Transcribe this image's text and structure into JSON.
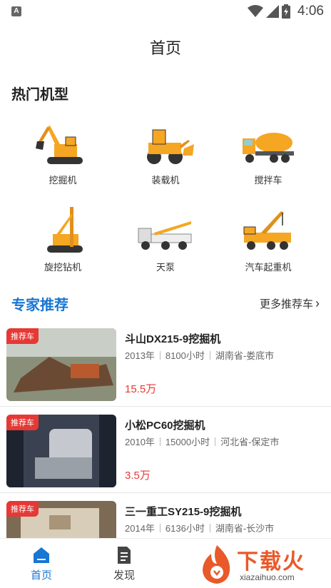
{
  "status": {
    "time": "4:06",
    "app_icon_letter": "A"
  },
  "header": {
    "title": "首页"
  },
  "hot_models": {
    "title": "热门机型",
    "items": [
      {
        "label": "挖掘机",
        "icon": "excavator-icon"
      },
      {
        "label": "装载机",
        "icon": "loader-icon"
      },
      {
        "label": "搅拌车",
        "icon": "mixer-truck-icon"
      },
      {
        "label": "旋挖钻机",
        "icon": "rotary-drill-icon"
      },
      {
        "label": "天泵",
        "icon": "pump-truck-icon"
      },
      {
        "label": "汽车起重机",
        "icon": "truck-crane-icon"
      }
    ]
  },
  "recommend": {
    "title": "专家推荐",
    "more_label": "更多推荐车",
    "badge": "推荐车",
    "items": [
      {
        "title": "斗山DX215-9挖掘机",
        "year": "2013年",
        "hours": "8100小时",
        "location": "湖南省-娄底市",
        "price": "15.5万"
      },
      {
        "title": "小松PC60挖掘机",
        "year": "2010年",
        "hours": "15000小时",
        "location": "河北省-保定市",
        "price": "3.5万"
      },
      {
        "title": "三一重工SY215-9挖掘机",
        "year": "2014年",
        "hours": "6136小时",
        "location": "湖南省-长沙市",
        "price": ""
      }
    ]
  },
  "tabs": [
    {
      "label": "首页",
      "icon": "home-icon",
      "active": true
    },
    {
      "label": "发现",
      "icon": "discover-icon",
      "active": false
    }
  ],
  "watermark": {
    "text": "下载火",
    "sub": "xiazaihuo.com"
  },
  "colors": {
    "accent": "#1976d2",
    "badge": "#e53935",
    "machine_yellow": "#f5a623"
  }
}
